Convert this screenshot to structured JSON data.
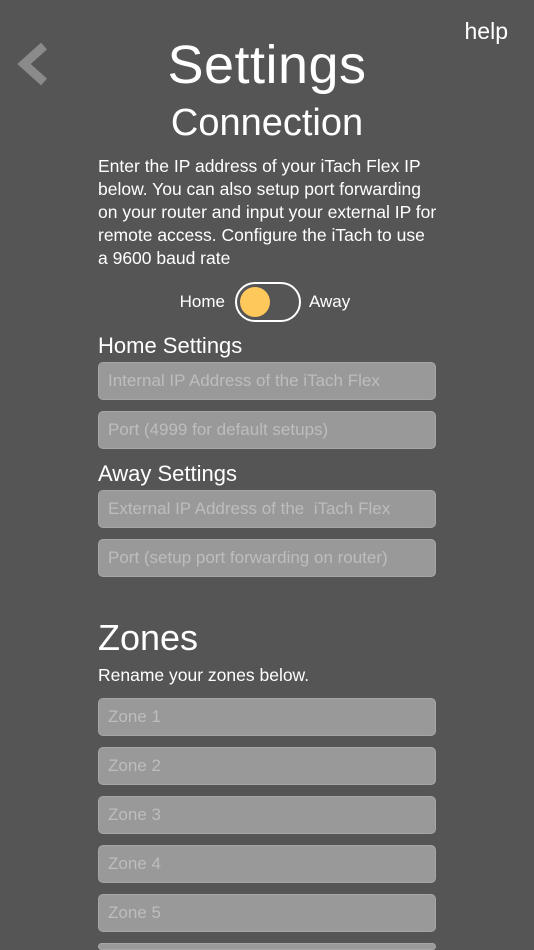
{
  "header": {
    "title": "Settings",
    "help_label": "help"
  },
  "connection": {
    "subtitle": "Connection",
    "intro": "Enter the IP address of your iTach Flex IP below. You can also setup port forwarding on your router and input your external IP for remote access. Configure the iTach to use a 9600 baud rate",
    "toggle": {
      "left_label": "Home",
      "right_label": "Away",
      "selected": "Home"
    }
  },
  "home_settings": {
    "heading": "Home Settings",
    "ip_placeholder": "Internal IP Address of the iTach Flex",
    "port_placeholder": "Port (4999 for default setups)"
  },
  "away_settings": {
    "heading": "Away Settings",
    "ip_placeholder": "External IP Address of the  iTach Flex",
    "port_placeholder": "Port (setup port forwarding on router)"
  },
  "zones": {
    "heading": "Zones",
    "subtitle": "Rename your zones below.",
    "fields": [
      {
        "placeholder": "Zone 1"
      },
      {
        "placeholder": "Zone 2"
      },
      {
        "placeholder": "Zone 3"
      },
      {
        "placeholder": "Zone 4"
      },
      {
        "placeholder": "Zone 5"
      },
      {
        "placeholder": ""
      }
    ]
  },
  "colors": {
    "background": "#555555",
    "field_background": "#999999",
    "accent": "#ffc85a",
    "text": "#ffffff"
  },
  "icons": {
    "back": "chevron-left-icon"
  }
}
